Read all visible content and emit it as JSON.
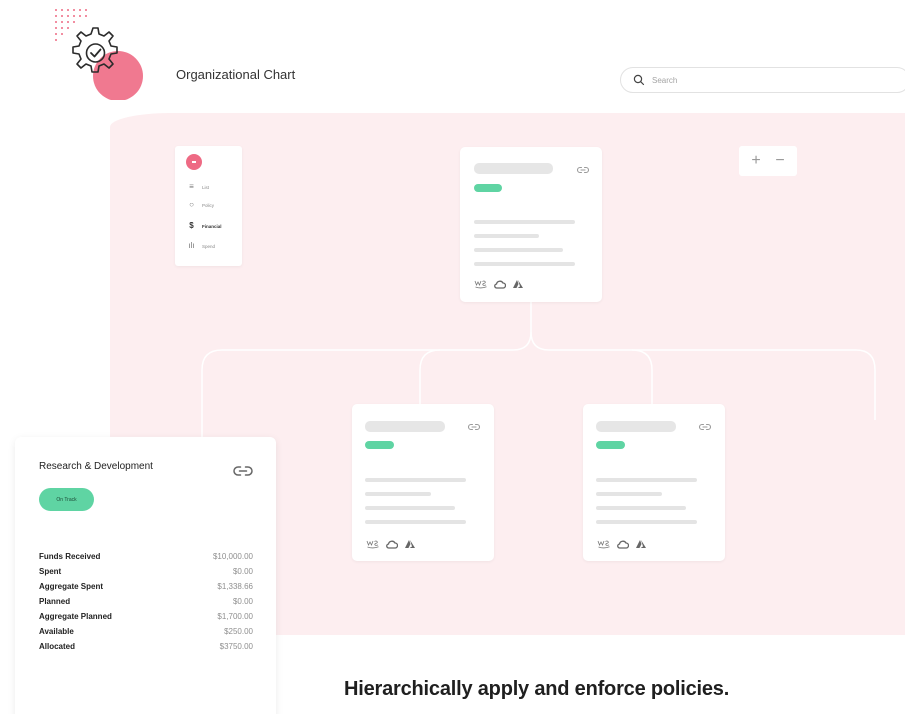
{
  "header": {
    "title": "Organizational Chart",
    "search_placeholder": "Search"
  },
  "side_menu": {
    "items": [
      {
        "label": "List",
        "icon": "list-icon"
      },
      {
        "label": "Policy",
        "icon": "circle-icon"
      },
      {
        "label": "Financial",
        "icon": "dollar-icon",
        "active": true
      },
      {
        "label": "Spend",
        "icon": "bar-chart-icon"
      }
    ]
  },
  "zoom": {
    "plus": "+",
    "minus": "−"
  },
  "detail_card": {
    "title": "Research & Development",
    "status": "On Track",
    "rows": [
      {
        "label": "Funds Received",
        "value": "$10,000.00"
      },
      {
        "label": "Spent",
        "value": "$0.00"
      },
      {
        "label": "Aggregate Spent",
        "value": "$1,338.66"
      },
      {
        "label": "Planned",
        "value": "$0.00"
      },
      {
        "label": "Aggregate Planned",
        "value": "$1,700.00"
      },
      {
        "label": "Available",
        "value": "$250.00"
      },
      {
        "label": "Allocated",
        "value": "$3750.00"
      }
    ]
  },
  "tagline": "Hierarchically apply and enforce policies.",
  "colors": {
    "accent": "#ee6a84",
    "status_green": "#5fd4a3",
    "canvas_bg": "#fdeef0"
  },
  "provider_icons": [
    "aws-icon",
    "gcp-cloud-icon",
    "azure-icon"
  ]
}
